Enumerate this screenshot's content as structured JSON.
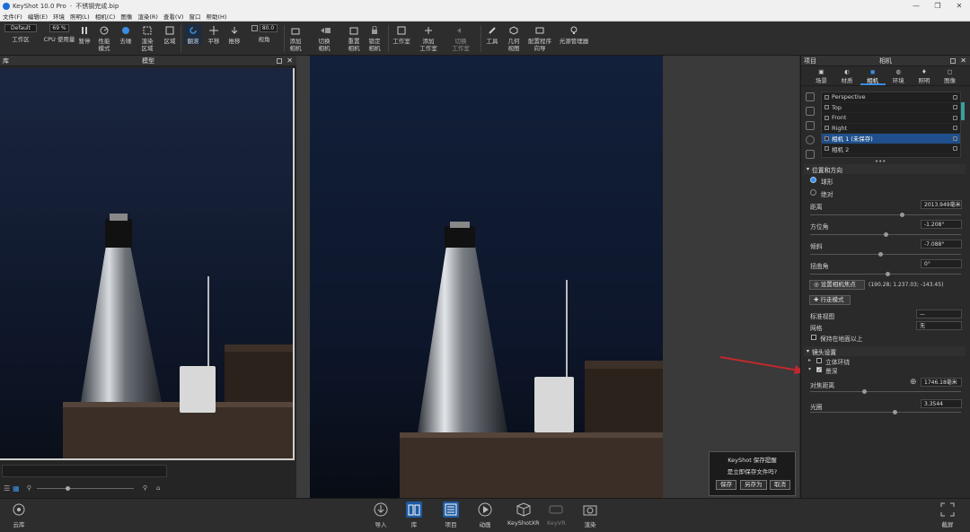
{
  "window": {
    "title": "KeyShot 10.0 Pro",
    "separator": "-",
    "document": "不锈钢完成.bip",
    "controls": [
      "—",
      "❐",
      "✕"
    ]
  },
  "menu": [
    "文件(F)",
    "编辑(E)",
    "环境",
    "照明(L)",
    "相机(C)",
    "图像",
    "渲染(R)",
    "查看(V)",
    "窗口",
    "帮助(H)"
  ],
  "toolbar": {
    "workspace_value": "Default",
    "workspace_label": "工作区",
    "cpu_value": "69 %",
    "cpu_label": "CPU 使用量",
    "pause_label": "暂停",
    "perf_label1": "性能",
    "perf_label2": "模式",
    "denoise_label": "去噪",
    "region1": "渲染",
    "region2": "区域",
    "region_label": "区域",
    "tumble_label": "翻滚",
    "pan_label": "平移",
    "dolly_label": "推移",
    "fov_value": "80.0",
    "fov_label": "视角",
    "addcam1": "添加",
    "addcam2": "相机",
    "switchcam1": "切换",
    "switchcam2": "相机",
    "resetcam1": "重置",
    "resetcam2": "相机",
    "lockcam1": "锁定",
    "lockcam2": "相机",
    "studio_label": "工作室",
    "addstudio1": "添加",
    "addstudio2": "工作室",
    "switchstudio1": "切换",
    "switchstudio2": "工作室",
    "tools_label": "工具",
    "geoview1": "几何",
    "geoview2": "视图",
    "configwiz1": "配置程序",
    "configwiz2": "向导",
    "lightmgr_label": "光源管理器"
  },
  "library_panel": {
    "title": "模型",
    "left_label": "库"
  },
  "project_panel": {
    "header_left": "项目",
    "title": "相机",
    "tabs": [
      "场景",
      "材质",
      "相机",
      "环境",
      "照明",
      "图像"
    ],
    "active_tab_index": 2,
    "cameras": [
      {
        "name": "Perspective",
        "selected": false
      },
      {
        "name": "Top",
        "selected": false
      },
      {
        "name": "Front",
        "selected": false
      },
      {
        "name": "Right",
        "selected": false
      },
      {
        "name": "相机 1 (未保存)",
        "selected": true
      },
      {
        "name": "相机 2",
        "selected": false
      }
    ],
    "more_indicator": "•••",
    "position_section": "位置和方向",
    "mode_orbit": "球形",
    "mode_absolute": "绝对",
    "distance_label": "距离",
    "distance_value": "2013.949毫米",
    "azimuth_label": "方位角",
    "azimuth_value": "-1.208°",
    "inclination_label": "倾斜",
    "inclination_value": "-7.088°",
    "twist_label": "扭曲角",
    "twist_value": "0°",
    "set_pivot_label": "设置相机焦点",
    "pivot_coords": "(190.28; 1.237.03; -143.45)",
    "walk_mode_label": "行走模式",
    "standard_view_label": "标准视图",
    "standard_view_value": "—",
    "grid_label": "网格",
    "grid_value": "无",
    "keep_above_ground_label": "保持在地面以上",
    "lens_section": "镜头设置",
    "stereo_label": "立体环绕",
    "dof_label": "景深",
    "dof_checked": true,
    "focus_distance_label": "对焦距离",
    "focus_distance_value": "1746.18毫米",
    "fstop_label": "光圈",
    "fstop_value": "3.3544"
  },
  "save_dialog": {
    "title": "KeyShot 保存提醒",
    "message": "是立即保存文件吗?",
    "save": "保存",
    "save_as": "另存为",
    "cancel": "取消"
  },
  "bottombar": {
    "cloud_label": "云库",
    "import_label": "导入",
    "library_label": "库",
    "project_label": "项目",
    "animation_label": "动画",
    "keyshotxr_label": "KeyShotXR",
    "keyvr_label": "KeyVR",
    "render_label": "渲染",
    "screenshot_label": "截屏"
  },
  "colors": {
    "accent": "#3a8de0",
    "selected_row": "#1f4f8c",
    "viewport_bg": "#0f1a2f",
    "annotation_arrow": "#c0282e"
  }
}
